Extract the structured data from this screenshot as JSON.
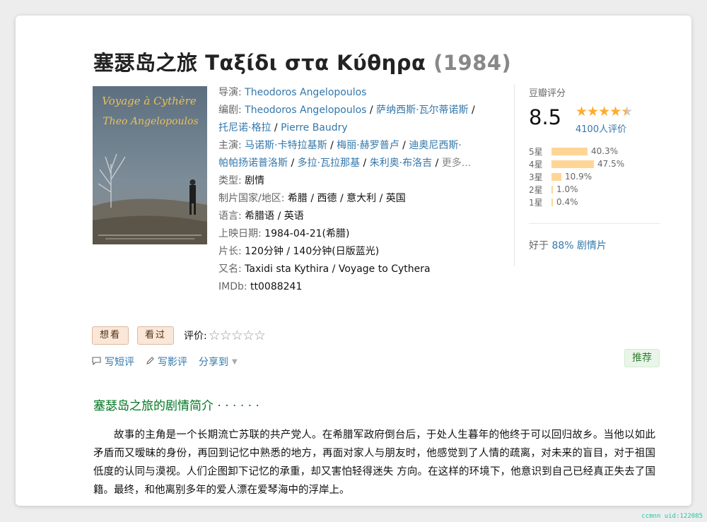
{
  "page": {
    "title": "塞瑟岛之旅 Ταξίδι στα Κύθηρα",
    "year": "(1984)"
  },
  "poster": {
    "line1": "Voyage à Cythère",
    "line2": "Theo Angelopoulos"
  },
  "info": {
    "director_label": "导演: ",
    "director": "Theodoros Angelopoulos",
    "writers_label": "编剧: ",
    "writers": [
      "Theodoros Angelopoulos",
      "萨纳西斯·瓦尔蒂诺斯",
      "托尼诺·格拉",
      "Pierre Baudry"
    ],
    "cast_label": "主演: ",
    "cast": [
      "马诺斯·卡特拉基斯",
      "梅丽·赫罗普卢",
      "迪奥尼西斯·帕帕扬诺普洛斯",
      "多拉·瓦拉那基",
      "朱利奥·布洛吉"
    ],
    "more": "更多...",
    "sep": " / ",
    "genre_label": "类型: ",
    "genre": "剧情",
    "country_label": "制片国家/地区: ",
    "country": "希腊 / 西德 / 意大利 / 英国",
    "language_label": "语言: ",
    "language": "希腊语 / 英语",
    "release_label": "上映日期: ",
    "release": "1984-04-21(希腊)",
    "runtime_label": "片长: ",
    "runtime": "120分钟 / 140分钟(日版蓝光)",
    "aka_label": "又名: ",
    "aka": "Taxidi sta Kythira / Voyage to Cythera",
    "imdb_label": "IMDb: ",
    "imdb": "tt0088241"
  },
  "rating": {
    "heading": "豆瓣评分",
    "score": "8.5",
    "stars": 4.5,
    "count_text": "4100人评价",
    "distribution": [
      {
        "label": "5星",
        "percent": 40.3,
        "text": "40.3%"
      },
      {
        "label": "4星",
        "percent": 47.5,
        "text": "47.5%"
      },
      {
        "label": "3星",
        "percent": 10.9,
        "text": "10.9%"
      },
      {
        "label": "2星",
        "percent": 1.0,
        "text": "1.0%"
      },
      {
        "label": "1星",
        "percent": 0.4,
        "text": "0.4%"
      }
    ],
    "better_prefix": "好于 ",
    "better_link": "88% 剧情片"
  },
  "actions": {
    "want": "想看",
    "seen": "看过",
    "rate_label": "评价:",
    "rate_stars": "☆☆☆☆☆",
    "short_review": "写短评",
    "review": "写影评",
    "share": "分享到",
    "recommend": "推荐"
  },
  "synopsis": {
    "title": "塞瑟岛之旅的剧情简介 · · · · · ·",
    "text": "故事的主角是一个长期流亡苏联的共产党人。在希腊军政府倒台后，于处人生暮年的他终于可以回归故乡。当他以如此矛盾而又暧昧的身份，再回到记忆中熟悉的地方，再面对家人与朋友时，他感觉到了人情的疏离，对未来的盲目，对于祖国低度的认同与漠视。人们企图卸下记忆的承重，却又害怕轻得迷失 方向。在这样的环境下，他意识到自己已经真正失去了国籍。最终，和他离别多年的爱人漂在爱琴海中的浮岸上。"
  },
  "watermark": "ccmnn  uid:122085"
}
